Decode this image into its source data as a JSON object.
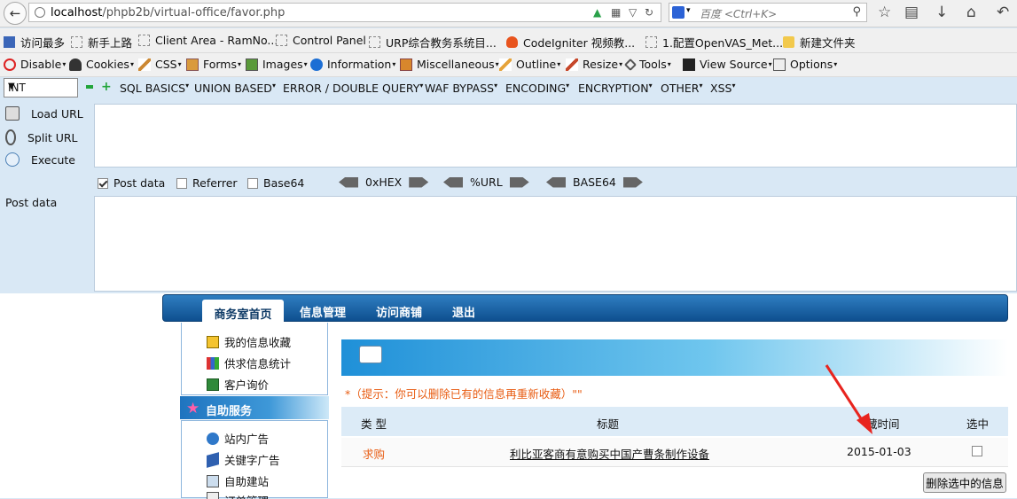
{
  "browser": {
    "url_host": "localhost",
    "url_path": "/phpb2b/virtual-office/favor.php",
    "search_placeholder": "百度 <Ctrl+K>"
  },
  "bookmarks": [
    {
      "label": "访问最多",
      "icon": "tool-icon"
    },
    {
      "label": "新手上路",
      "icon": "page-icon"
    },
    {
      "label": "Client Area - RamNo...",
      "icon": "page-icon"
    },
    {
      "label": "Control Panel",
      "icon": "page-icon"
    },
    {
      "label": "URP综合教务系统目...",
      "icon": "page-icon"
    },
    {
      "label": "CodeIgniter 视频教...",
      "icon": "fire-icon"
    },
    {
      "label": "1.配置OpenVAS_Met...",
      "icon": "page-icon"
    },
    {
      "label": "新建文件夹",
      "icon": "folder-icon"
    }
  ],
  "webdev": [
    "Disable",
    "Cookies",
    "CSS",
    "Forms",
    "Images",
    "Information",
    "Miscellaneous",
    "Outline",
    "Resize",
    "Tools",
    "View Source",
    "Options"
  ],
  "hackbar": {
    "select_value": "INT",
    "menus": [
      "SQL BASICS",
      "UNION BASED",
      "ERROR / DOUBLE QUERY",
      "WAF BYPASS",
      "ENCODING",
      "ENCRYPTION",
      "OTHER",
      "XSS"
    ],
    "actions": [
      "Load URL",
      "Split URL",
      "Execute"
    ],
    "options": {
      "post_data": "Post data",
      "referrer": "Referrer",
      "base64": "Base64"
    },
    "encoders": [
      "0xHEX",
      "%URL",
      "BASE64"
    ],
    "post_data_label": "Post data"
  },
  "site": {
    "nav": [
      "商务室首页",
      "信息管理",
      "访问商铺",
      "退出"
    ],
    "left_menu_top": [
      "我的信息收藏",
      "供求信息统计",
      "客户询价"
    ],
    "section_title": "自助服务",
    "left_menu_bottom": [
      "站内广告",
      "关键字广告",
      "自助建站",
      "订单管理"
    ],
    "hint": "*（提示：你可以删除已有的信息再重新收藏）\"\"",
    "table_headers": [
      "类 型",
      "标题",
      "藏时间",
      "选中"
    ],
    "rows": [
      {
        "type": "求购",
        "title": "利比亚客商有意购买中国产曹条制作设备",
        "date": "2015-01-03",
        "checked": false
      }
    ],
    "delete_button": "删除选中的信息"
  },
  "colors": {
    "accent_orange": "#e85c12",
    "nav_blue": "#0e4f8f",
    "annotation_red": "#e8241e"
  }
}
